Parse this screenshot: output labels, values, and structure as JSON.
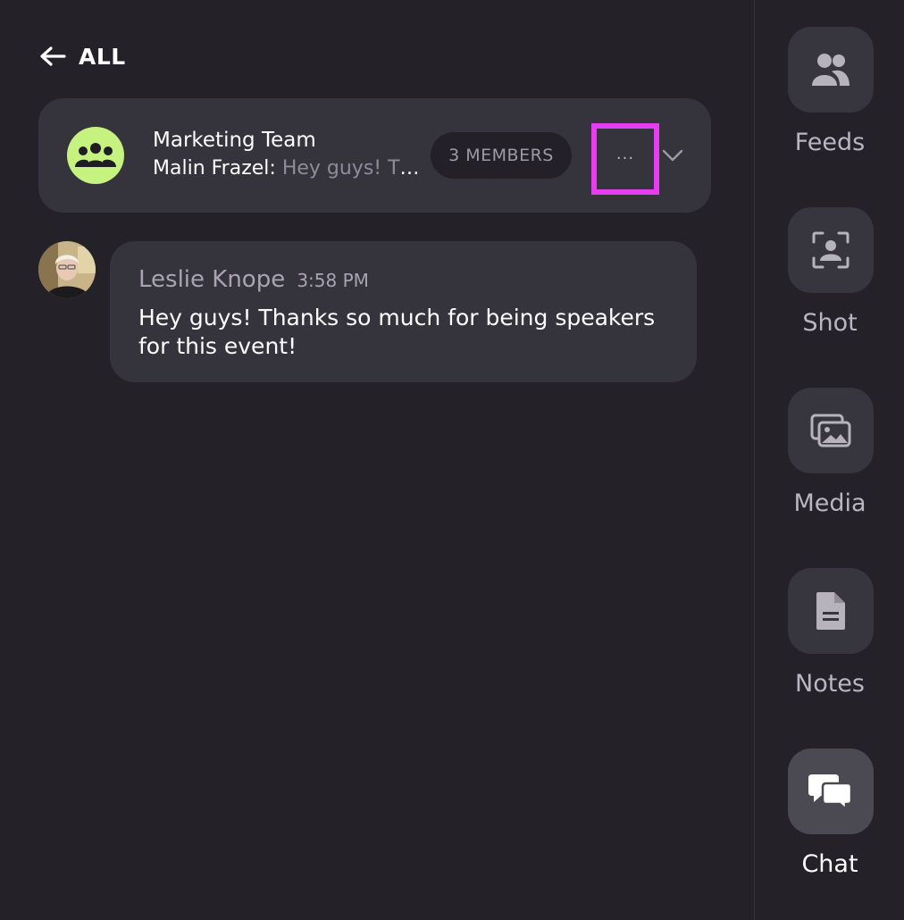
{
  "header": {
    "back_label": "ALL"
  },
  "group": {
    "name": "Marketing Team",
    "preview_author": "Malin Frazel:",
    "preview_text": "Hey guys! Thanks so much for being speakers for this event!",
    "members_label": "3 MEMBERS",
    "more_label": "···",
    "avatar_color": "#c6f27f"
  },
  "message": {
    "sender": "Leslie Knope",
    "time": "3:58 PM",
    "text": "Hey guys! Thanks so much for being speakers for this event!"
  },
  "sidebar": {
    "items": [
      {
        "label": "Feeds",
        "icon": "people-icon",
        "active": false
      },
      {
        "label": "Shot",
        "icon": "portrait-frame-icon",
        "active": false
      },
      {
        "label": "Media",
        "icon": "images-icon",
        "active": false
      },
      {
        "label": "Notes",
        "icon": "document-icon",
        "active": false
      },
      {
        "label": "Chat",
        "icon": "chat-bubbles-icon",
        "active": true
      }
    ]
  },
  "colors": {
    "background": "#242228",
    "card": "#35333b",
    "highlight_border": "#e83cf0",
    "accent": "#c6f27f"
  }
}
